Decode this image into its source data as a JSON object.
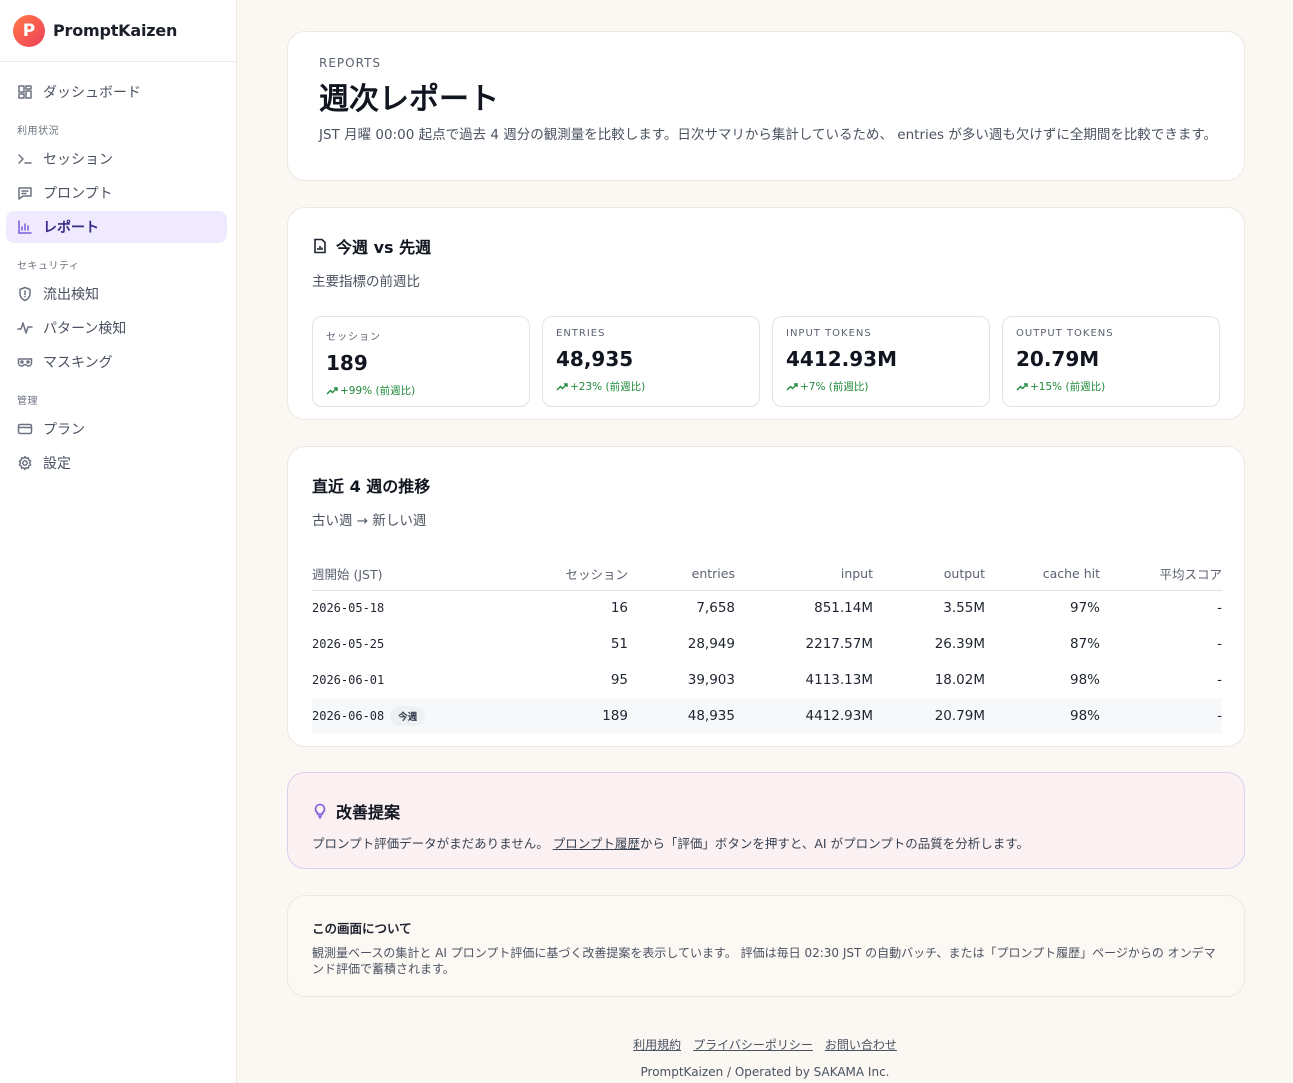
{
  "brand": {
    "initial": "P",
    "name": "PromptKaizen"
  },
  "sidebar": {
    "dashboard": "ダッシュボード",
    "group_usage": "利用状況",
    "sessions": "セッション",
    "prompts": "プロンプト",
    "reports": "レポート",
    "group_security": "セキュリティ",
    "leak_detection": "流出検知",
    "pattern_detection": "パターン検知",
    "masking": "マスキング",
    "group_admin": "管理",
    "plan": "プラン",
    "settings": "設定"
  },
  "header": {
    "eyebrow": "REPORTS",
    "title": "週次レポート",
    "description": "JST 月曜 00:00 起点で過去 4 週分の観測量を比較します。日次サマリから集計しているため、 entries が多い週も欠けずに全期間を比較できます。"
  },
  "compare": {
    "title": "今週 vs 先週",
    "subtitle": "主要指標の前週比",
    "metrics": [
      {
        "label": "セッション",
        "value": "189",
        "delta": "+99% (前週比)"
      },
      {
        "label": "ENTRIES",
        "value": "48,935",
        "delta": "+23% (前週比)"
      },
      {
        "label": "INPUT TOKENS",
        "value": "4412.93M",
        "delta": "+7% (前週比)"
      },
      {
        "label": "OUTPUT TOKENS",
        "value": "20.79M",
        "delta": "+15% (前週比)"
      }
    ]
  },
  "trend": {
    "title": "直近 4 週の推移",
    "subtitle": "古い週 → 新しい週",
    "columns": [
      "週開始 (JST)",
      "セッション",
      "entries",
      "input",
      "output",
      "cache hit",
      "平均スコア"
    ],
    "rows": [
      [
        "2026-05-18",
        "16",
        "7,658",
        "851.14M",
        "3.55M",
        "97%",
        "-"
      ],
      [
        "2026-05-25",
        "51",
        "28,949",
        "2217.57M",
        "26.39M",
        "87%",
        "-"
      ],
      [
        "2026-06-01",
        "95",
        "39,903",
        "4113.13M",
        "18.02M",
        "98%",
        "-"
      ],
      [
        "2026-06-08",
        "189",
        "48,935",
        "4412.93M",
        "20.79M",
        "98%",
        "-"
      ]
    ],
    "current_badge": "今週"
  },
  "suggest": {
    "title": "改善提案",
    "text_before": "プロンプト評価データがまだありません。 ",
    "link": "プロンプト履歴",
    "text_after": "から「評価」ボタンを押すと、AI がプロンプトの品質を分析します。"
  },
  "about": {
    "title": "この画面について",
    "text": "観測量ベースの集計と AI プロンプト評価に基づく改善提案を表示しています。 評価は毎日 02:30 JST の自動バッチ、または「プロンプト履歴」ページからの オンデマンド評価で蓄積されます。"
  },
  "footer": {
    "terms": "利用規約",
    "privacy": "プライバシーポリシー",
    "contact": "お問い合わせ",
    "copyright": "PromptKaizen / Operated by SAKAMA Inc."
  },
  "colors": {
    "accent": "#7b5cdc",
    "positive": "#1f8a3a",
    "brand_start": "#ff7a45",
    "brand_end": "#ef3f5c"
  }
}
